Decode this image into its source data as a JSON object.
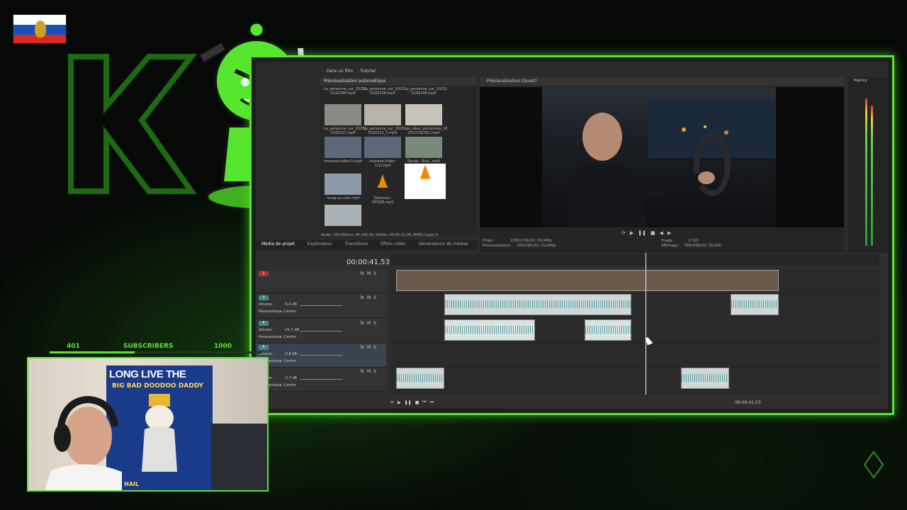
{
  "colors": {
    "accent_green": "#57e62f",
    "flag_white": "#ffffff",
    "flag_blue": "#1c4fb8",
    "flag_red": "#d52b1e"
  },
  "app": {
    "topbar": {
      "items": [
        "Faire un film",
        "Tutoriel"
      ]
    },
    "media": {
      "header": "Prévisualisation automatique",
      "thumbnails": [
        {
          "label": "La_personne_sur_20251 0192240.mp4",
          "l2": ""
        },
        {
          "label": "La_personne_sur_20251 0192239.mp4",
          "l2": ""
        },
        {
          "label": "La_personne_sur_20251 0192240.mp4",
          "l2": ""
        },
        {
          "label": "La_personne_sur_20251 0192311.mp4",
          "l2": ""
        },
        {
          "label": "La_personne_sur_20251 0192311_1.mp4",
          "l2": ""
        },
        {
          "label": "Les_deux_personnes_20 2510192301.mp4",
          "l2": ""
        },
        {
          "label": "lmarena-video-0.mp4",
          "l2": ""
        },
        {
          "label": "lmarena-video-1(1).mp4",
          "l2": ""
        },
        {
          "label": "Recap - End...mp4",
          "l2": ""
        },
        {
          "label": "recap au coin.mp4",
          "l2": ""
        },
        {
          "label": "Semonie - OPSOR.mp3",
          "l2": ""
        },
        {
          "label": "",
          "l2": ""
        }
      ],
      "status": "Audio: 320 Kbits/s, 44 100 Hz, Stéréo, 00:00:22,06; MPEG Layer-3"
    },
    "tabs": [
      "Média de projet",
      "Explorateur",
      "Transitions",
      "Effets vidéo",
      "Générateurs de médias"
    ],
    "preview": {
      "header": "Prévisualisation (Quart)",
      "info_left_1": "Projet :",
      "info_left_1v": "1280x720x32; 59,940p",
      "info_left_2": "Prévisualisation :",
      "info_left_2v": "320x180x32; 59,940p",
      "info_right_1": "Image :",
      "info_right_1v": "2 510",
      "info_right_2": "Affichage :",
      "info_right_2v": "708x398x32; 59,940"
    },
    "meter": {
      "label": "Matrice"
    },
    "timeline": {
      "time": "00:00:41,53",
      "tracks": [
        {
          "num": "2",
          "type": "video"
        },
        {
          "num": "3",
          "vol_label": "Volume :",
          "vol": "-5,4 dB",
          "pan_label": "Panoramique :",
          "pan": "Centre"
        },
        {
          "num": "4",
          "vol_label": "Volume :",
          "vol": "-21,7 dB",
          "pan_label": "Panoramique :",
          "pan": "Centre"
        },
        {
          "num": "5",
          "vol_label": "Volume :",
          "vol": "-3,8 dB",
          "pan_label": "Panoramique :",
          "pan": "Centre"
        },
        {
          "num": "6",
          "vol_label": "Volume :",
          "vol": "-2,7 dB",
          "pan_label": "Panoramique :",
          "pan": "Centre"
        }
      ],
      "bottom_time": "00:00:41,53"
    }
  },
  "stream": {
    "subs_current": "401",
    "subs_label": "SUBSCRIBERS",
    "subs_goal": "1000",
    "subs_progress": 0.401,
    "poster_title": "LONG LIVE THE",
    "poster_sub": "BIG BAD DOODOO DADDY",
    "poster_bottom": "ALL HAIL"
  }
}
